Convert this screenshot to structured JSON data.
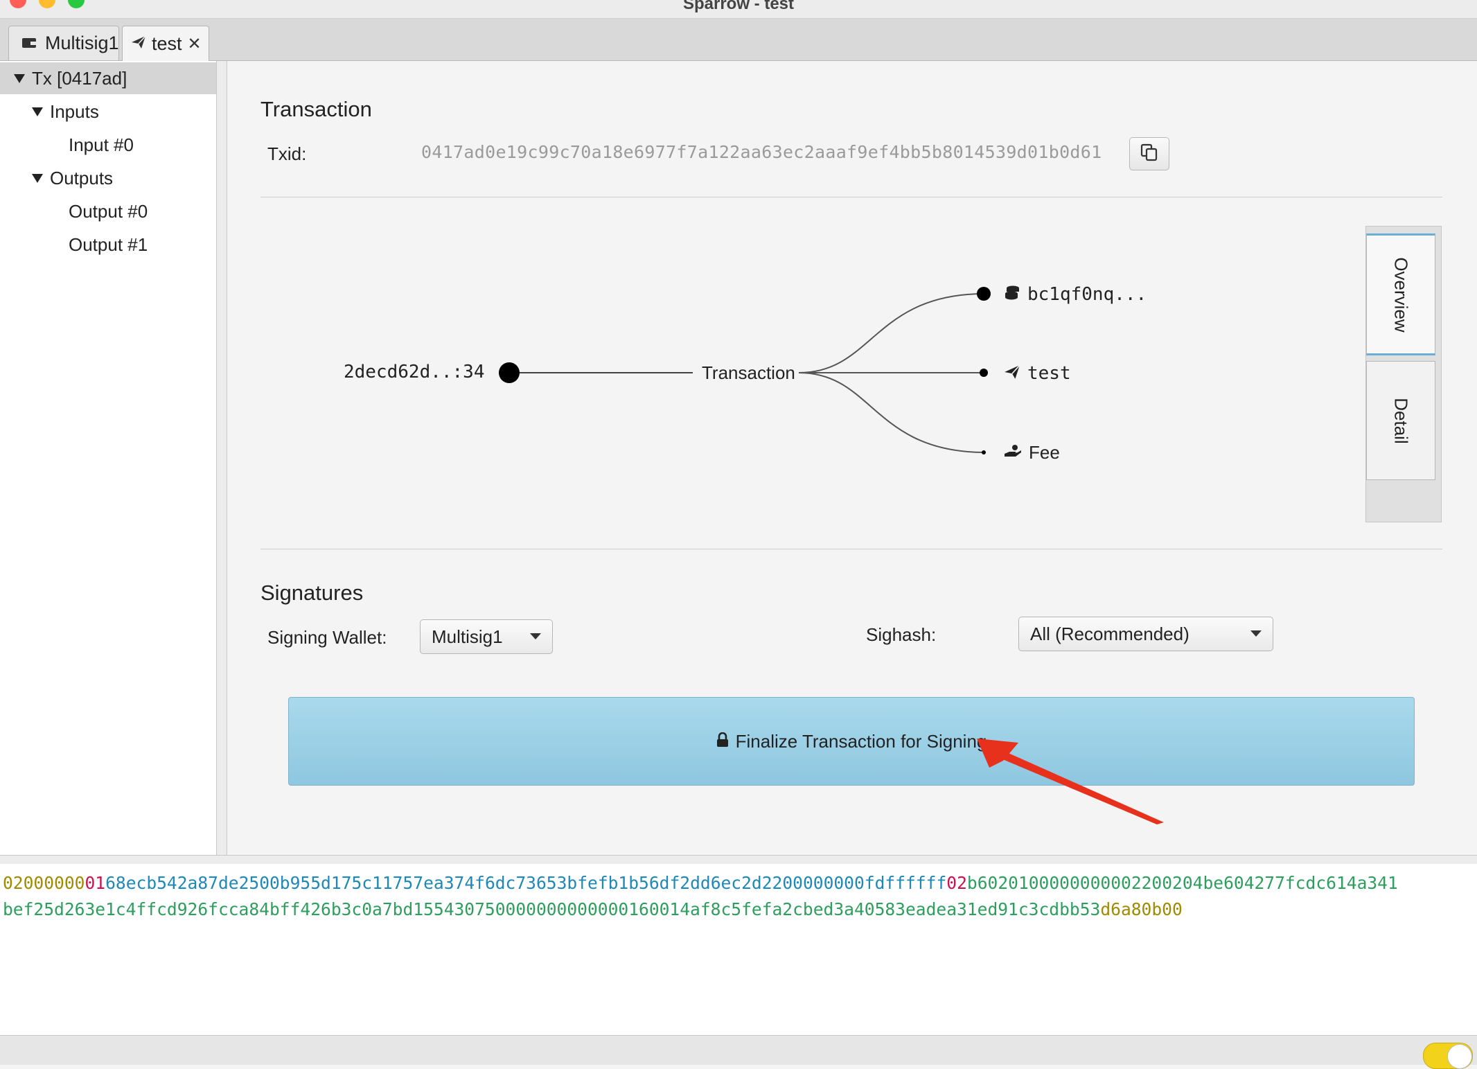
{
  "window": {
    "title": "Sparrow - test"
  },
  "tabs": [
    {
      "label": "Multisig1",
      "icon": "wallet-icon"
    },
    {
      "label": "test",
      "icon": "send-icon",
      "close": "✕"
    }
  ],
  "tree": {
    "root": "Tx [0417ad]",
    "inputs_label": "Inputs",
    "input_0": "Input #0",
    "outputs_label": "Outputs",
    "output_0": "Output #0",
    "output_1": "Output #1"
  },
  "transaction": {
    "heading": "Transaction",
    "txid_label": "Txid:",
    "txid": "0417ad0e19c99c70a18e6977f7a122aa63ec2aaaf9ef4bb5b8014539d01b0d61"
  },
  "diagram": {
    "input": "2decd62d..:34",
    "center": "Transaction",
    "output_address": "bc1qf0nq...",
    "output_change": "test",
    "fee": "Fee"
  },
  "side_tabs": {
    "overview": "Overview",
    "detail": "Detail"
  },
  "signatures": {
    "heading": "Signatures",
    "wallet_label": "Signing Wallet:",
    "wallet_value": "Multisig1",
    "sighash_label": "Sighash:",
    "sighash_value": "All (Recommended)",
    "finalize_label": "Finalize Transaction for Signing"
  },
  "hex": {
    "line1": [
      {
        "t": "02000000",
        "c": "#a08a00"
      },
      {
        "t": "01",
        "c": "#d0104c"
      },
      {
        "t": "68ecb542a87de2500b955d175c11757ea374f6dc73653bfefb1b56df2dd6ec2d22",
        "c": "#1e88b8"
      },
      {
        "t": "00000000",
        "c": "#1e88b8"
      },
      {
        "t": "fdffffff",
        "c": "#1e88b8"
      },
      {
        "t": "02",
        "c": "#d0104c"
      },
      {
        "t": "b602010000000000220020",
        "c": "#2e9e5e"
      },
      {
        "t": "4be604277fcdc614a341",
        "c": "#2e9e5e"
      }
    ],
    "line2": [
      {
        "t": "bef25d263e1c4ffcd926fcca84bff426b3c0a7bd155430750000000000000160014af8c5fefa2cbed3a40583eadea31ed91c3cdbb53",
        "c": "#2e9e5e"
      },
      {
        "t": "d6a80b00",
        "c": "#a08a00"
      }
    ]
  },
  "colors": {
    "accent": "#9fd2e8",
    "arrow": "#e8311c"
  }
}
